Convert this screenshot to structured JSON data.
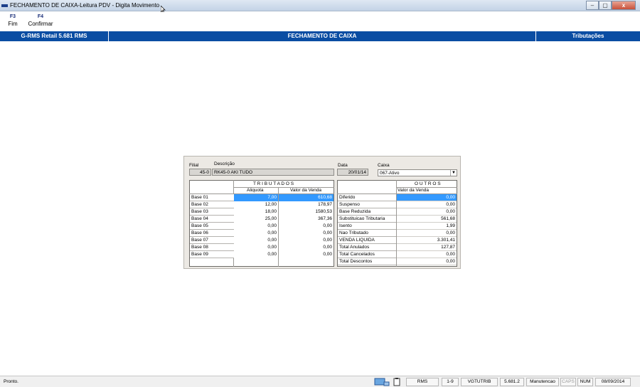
{
  "window": {
    "title": "FECHAMENTO DE CAIXA-Leitura PDV - Digita Movimento",
    "buttons": {
      "min": "–",
      "max": "▢",
      "close": "x"
    }
  },
  "toolbar": [
    {
      "key": "F3",
      "label": "Fim"
    },
    {
      "key": "F4",
      "label": "Confirmar"
    }
  ],
  "header": {
    "left": "G-RMS Retail 5.681 RMS",
    "center": "FECHAMENTO DE CAIXA",
    "right": "Tributações"
  },
  "form": {
    "filial_label": "Filial",
    "filial_value": "45-0",
    "descricao_label": "Descrição",
    "descricao_value": "RK45-0 AKI TUDO",
    "data_label": "Data",
    "data_value": "20/01/14",
    "caixa_label": "Caixa",
    "caixa_value": "067-Ativo"
  },
  "tributados": {
    "title": "T R I B U T A D O S",
    "col_aliquota": "Aliquota",
    "col_valor": "Valor da Venda",
    "rows": [
      {
        "label": "Base 01",
        "aliquota": "7,00",
        "valor": "610,68"
      },
      {
        "label": "Base 02",
        "aliquota": "12,00",
        "valor": "178,97"
      },
      {
        "label": "Base 03",
        "aliquota": "18,00",
        "valor": "1580,53"
      },
      {
        "label": "Base 04",
        "aliquota": "25,00",
        "valor": "367,36"
      },
      {
        "label": "Base 05",
        "aliquota": "0,00",
        "valor": "0,00"
      },
      {
        "label": "Base 06",
        "aliquota": "0,00",
        "valor": "0,00"
      },
      {
        "label": "Base 07",
        "aliquota": "0,00",
        "valor": "0,00"
      },
      {
        "label": "Base 08",
        "aliquota": "0,00",
        "valor": "0,00"
      },
      {
        "label": "Base 09",
        "aliquota": "0,00",
        "valor": "0,00"
      }
    ]
  },
  "outros": {
    "title": "O U T R O S",
    "col_valor": "Valor da Venda",
    "rows": [
      {
        "label": "Diferido",
        "valor": "0,00"
      },
      {
        "label": "Suspenso",
        "valor": "0,00"
      },
      {
        "label": "Base Reduzida",
        "valor": "0,00"
      },
      {
        "label": "Substituicao Tributaria",
        "valor": "561,68"
      },
      {
        "label": "Isento",
        "valor": "1,99"
      },
      {
        "label": "Nao Tributado",
        "valor": "0,00"
      },
      {
        "label": "VENDA LIQUIDA",
        "valor": "3.301,41"
      },
      {
        "label": "Total Anulados",
        "valor": "127,87"
      },
      {
        "label": "Total Cancelados",
        "valor": "0,00"
      },
      {
        "label": "Total Descontos",
        "valor": "0,00"
      }
    ]
  },
  "status": {
    "ready": "Pronto.",
    "rms": "RMS",
    "range": "1-9",
    "program": "VGTUTRIB",
    "version": "5.681.2",
    "mode": "Manutencao",
    "caps": "CAPS",
    "num": "NUM",
    "date": "08/09/2014"
  },
  "colors": {
    "header": "#0a4da3",
    "selection": "#3399ff"
  }
}
